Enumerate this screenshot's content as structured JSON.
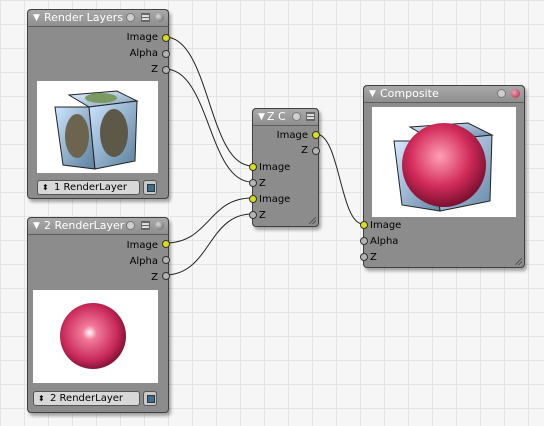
{
  "nodes": {
    "render_layers_1": {
      "title": "Render Layers",
      "outputs": [
        "Image",
        "Alpha",
        "Z"
      ],
      "layer_select": "1 RenderLayer"
    },
    "render_layer_2": {
      "title": "2 RenderLayer",
      "outputs": [
        "Image",
        "Alpha",
        "Z"
      ],
      "layer_select": "2 RenderLayer"
    },
    "zcombine": {
      "title": "Z C",
      "inputs": [
        "Image",
        "Z",
        "Image",
        "Z"
      ],
      "outputs": [
        "Image",
        "Z"
      ]
    },
    "composite": {
      "title": "Composite",
      "inputs": [
        "Image",
        "Alpha",
        "Z"
      ]
    }
  },
  "icons": {
    "collapse": "triangle-down-icon",
    "image_socket_color": "#dcdc1c",
    "value_socket_color": "#b4b4b4",
    "wire_color": "#222222"
  }
}
